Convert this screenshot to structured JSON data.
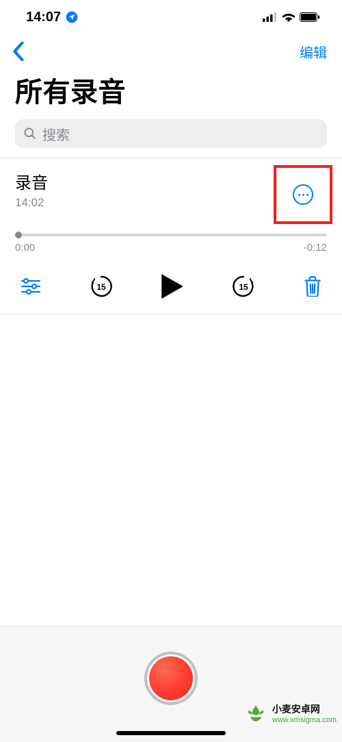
{
  "status_bar": {
    "time": "14:07"
  },
  "nav": {
    "edit_label": "编辑"
  },
  "page_title": "所有录音",
  "search": {
    "placeholder": "搜索"
  },
  "recording": {
    "title": "录音",
    "time": "14:02",
    "elapsed": "0:00",
    "remaining": "-0:12",
    "skip_seconds": "15"
  },
  "colors": {
    "accent": "#007aff",
    "record": "#ff3b30",
    "highlight_box": "#ff1a1a"
  },
  "watermark": {
    "name": "小麦安卓网",
    "url": "www.xmsigma.com"
  }
}
